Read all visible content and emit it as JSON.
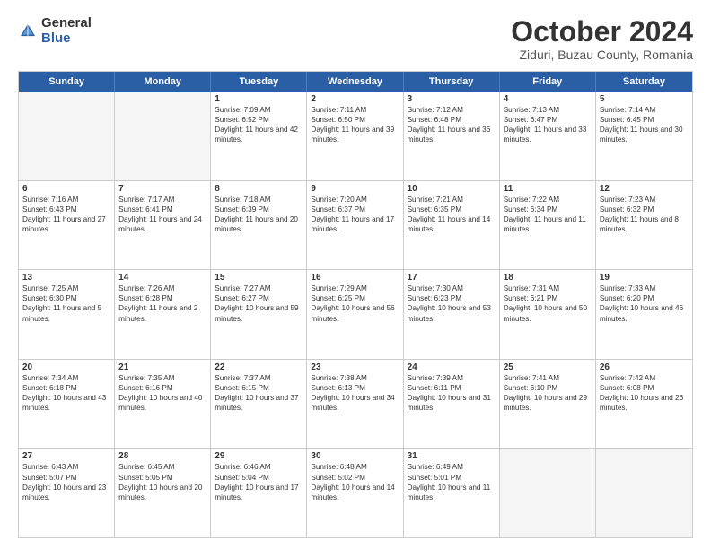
{
  "logo": {
    "general": "General",
    "blue": "Blue"
  },
  "header": {
    "month": "October 2024",
    "location": "Ziduri, Buzau County, Romania"
  },
  "weekdays": [
    "Sunday",
    "Monday",
    "Tuesday",
    "Wednesday",
    "Thursday",
    "Friday",
    "Saturday"
  ],
  "rows": [
    [
      {
        "day": "",
        "empty": true
      },
      {
        "day": "",
        "empty": true
      },
      {
        "day": "1",
        "sunrise": "Sunrise: 7:09 AM",
        "sunset": "Sunset: 6:52 PM",
        "daylight": "Daylight: 11 hours and 42 minutes."
      },
      {
        "day": "2",
        "sunrise": "Sunrise: 7:11 AM",
        "sunset": "Sunset: 6:50 PM",
        "daylight": "Daylight: 11 hours and 39 minutes."
      },
      {
        "day": "3",
        "sunrise": "Sunrise: 7:12 AM",
        "sunset": "Sunset: 6:48 PM",
        "daylight": "Daylight: 11 hours and 36 minutes."
      },
      {
        "day": "4",
        "sunrise": "Sunrise: 7:13 AM",
        "sunset": "Sunset: 6:47 PM",
        "daylight": "Daylight: 11 hours and 33 minutes."
      },
      {
        "day": "5",
        "sunrise": "Sunrise: 7:14 AM",
        "sunset": "Sunset: 6:45 PM",
        "daylight": "Daylight: 11 hours and 30 minutes."
      }
    ],
    [
      {
        "day": "6",
        "sunrise": "Sunrise: 7:16 AM",
        "sunset": "Sunset: 6:43 PM",
        "daylight": "Daylight: 11 hours and 27 minutes."
      },
      {
        "day": "7",
        "sunrise": "Sunrise: 7:17 AM",
        "sunset": "Sunset: 6:41 PM",
        "daylight": "Daylight: 11 hours and 24 minutes."
      },
      {
        "day": "8",
        "sunrise": "Sunrise: 7:18 AM",
        "sunset": "Sunset: 6:39 PM",
        "daylight": "Daylight: 11 hours and 20 minutes."
      },
      {
        "day": "9",
        "sunrise": "Sunrise: 7:20 AM",
        "sunset": "Sunset: 6:37 PM",
        "daylight": "Daylight: 11 hours and 17 minutes."
      },
      {
        "day": "10",
        "sunrise": "Sunrise: 7:21 AM",
        "sunset": "Sunset: 6:35 PM",
        "daylight": "Daylight: 11 hours and 14 minutes."
      },
      {
        "day": "11",
        "sunrise": "Sunrise: 7:22 AM",
        "sunset": "Sunset: 6:34 PM",
        "daylight": "Daylight: 11 hours and 11 minutes."
      },
      {
        "day": "12",
        "sunrise": "Sunrise: 7:23 AM",
        "sunset": "Sunset: 6:32 PM",
        "daylight": "Daylight: 11 hours and 8 minutes."
      }
    ],
    [
      {
        "day": "13",
        "sunrise": "Sunrise: 7:25 AM",
        "sunset": "Sunset: 6:30 PM",
        "daylight": "Daylight: 11 hours and 5 minutes."
      },
      {
        "day": "14",
        "sunrise": "Sunrise: 7:26 AM",
        "sunset": "Sunset: 6:28 PM",
        "daylight": "Daylight: 11 hours and 2 minutes."
      },
      {
        "day": "15",
        "sunrise": "Sunrise: 7:27 AM",
        "sunset": "Sunset: 6:27 PM",
        "daylight": "Daylight: 10 hours and 59 minutes."
      },
      {
        "day": "16",
        "sunrise": "Sunrise: 7:29 AM",
        "sunset": "Sunset: 6:25 PM",
        "daylight": "Daylight: 10 hours and 56 minutes."
      },
      {
        "day": "17",
        "sunrise": "Sunrise: 7:30 AM",
        "sunset": "Sunset: 6:23 PM",
        "daylight": "Daylight: 10 hours and 53 minutes."
      },
      {
        "day": "18",
        "sunrise": "Sunrise: 7:31 AM",
        "sunset": "Sunset: 6:21 PM",
        "daylight": "Daylight: 10 hours and 50 minutes."
      },
      {
        "day": "19",
        "sunrise": "Sunrise: 7:33 AM",
        "sunset": "Sunset: 6:20 PM",
        "daylight": "Daylight: 10 hours and 46 minutes."
      }
    ],
    [
      {
        "day": "20",
        "sunrise": "Sunrise: 7:34 AM",
        "sunset": "Sunset: 6:18 PM",
        "daylight": "Daylight: 10 hours and 43 minutes."
      },
      {
        "day": "21",
        "sunrise": "Sunrise: 7:35 AM",
        "sunset": "Sunset: 6:16 PM",
        "daylight": "Daylight: 10 hours and 40 minutes."
      },
      {
        "day": "22",
        "sunrise": "Sunrise: 7:37 AM",
        "sunset": "Sunset: 6:15 PM",
        "daylight": "Daylight: 10 hours and 37 minutes."
      },
      {
        "day": "23",
        "sunrise": "Sunrise: 7:38 AM",
        "sunset": "Sunset: 6:13 PM",
        "daylight": "Daylight: 10 hours and 34 minutes."
      },
      {
        "day": "24",
        "sunrise": "Sunrise: 7:39 AM",
        "sunset": "Sunset: 6:11 PM",
        "daylight": "Daylight: 10 hours and 31 minutes."
      },
      {
        "day": "25",
        "sunrise": "Sunrise: 7:41 AM",
        "sunset": "Sunset: 6:10 PM",
        "daylight": "Daylight: 10 hours and 29 minutes."
      },
      {
        "day": "26",
        "sunrise": "Sunrise: 7:42 AM",
        "sunset": "Sunset: 6:08 PM",
        "daylight": "Daylight: 10 hours and 26 minutes."
      }
    ],
    [
      {
        "day": "27",
        "sunrise": "Sunrise: 6:43 AM",
        "sunset": "Sunset: 5:07 PM",
        "daylight": "Daylight: 10 hours and 23 minutes."
      },
      {
        "day": "28",
        "sunrise": "Sunrise: 6:45 AM",
        "sunset": "Sunset: 5:05 PM",
        "daylight": "Daylight: 10 hours and 20 minutes."
      },
      {
        "day": "29",
        "sunrise": "Sunrise: 6:46 AM",
        "sunset": "Sunset: 5:04 PM",
        "daylight": "Daylight: 10 hours and 17 minutes."
      },
      {
        "day": "30",
        "sunrise": "Sunrise: 6:48 AM",
        "sunset": "Sunset: 5:02 PM",
        "daylight": "Daylight: 10 hours and 14 minutes."
      },
      {
        "day": "31",
        "sunrise": "Sunrise: 6:49 AM",
        "sunset": "Sunset: 5:01 PM",
        "daylight": "Daylight: 10 hours and 11 minutes."
      },
      {
        "day": "",
        "empty": true
      },
      {
        "day": "",
        "empty": true
      }
    ]
  ]
}
